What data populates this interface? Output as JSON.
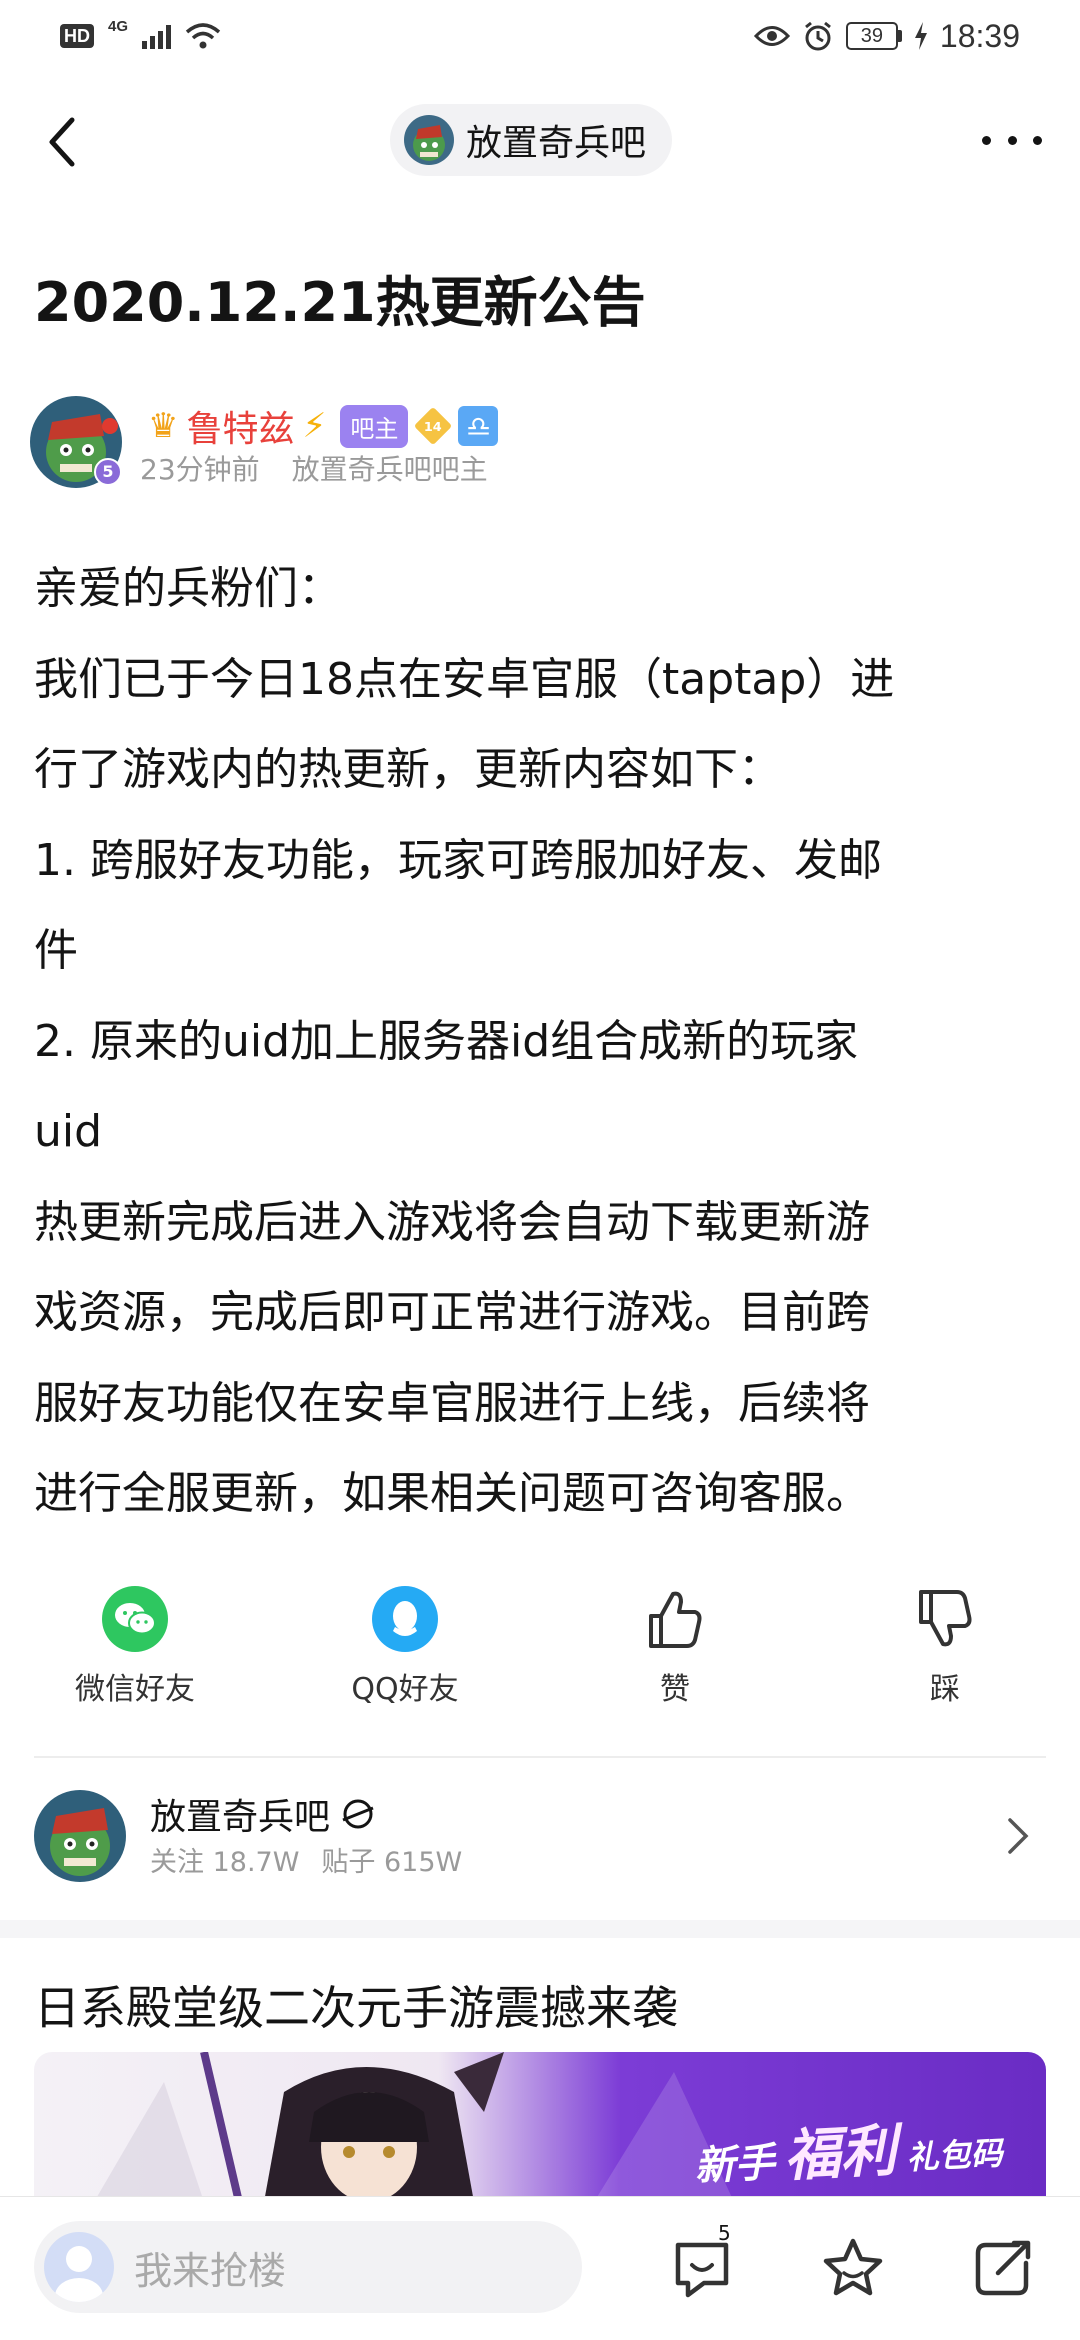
{
  "status_bar": {
    "hd": "HD",
    "network": "4G",
    "battery": "39",
    "time": "18:39"
  },
  "nav": {
    "forum_name": "放置奇兵吧"
  },
  "post": {
    "title": "2020.12.21热更新公告",
    "author": {
      "name": "鲁特兹",
      "role_tag": "吧主",
      "level": "14",
      "avatar_level": "5",
      "time": "23分钟前",
      "description": "放置奇兵吧吧主"
    },
    "content_lines": [
      "亲爱的兵粉们：",
      "我们已于今日18点在安卓官服（taptap）进",
      "行了游戏内的热更新，更新内容如下：",
      "1. 跨服好友功能，玩家可跨服加好友、发邮",
      "件",
      "2. 原来的uid加上服务器id组合成新的玩家",
      "uid",
      "热更新完成后进入游戏将会自动下载更新游",
      "戏资源，完成后即可正常进行游戏。目前跨",
      "服好友功能仅在安卓官服进行上线，后续将",
      "进行全服更新，如果相关问题可咨询客服。"
    ]
  },
  "actions": {
    "wechat": "微信好友",
    "qq": "QQ好友",
    "like": "赞",
    "dislike": "踩"
  },
  "forum_card": {
    "name": "放置奇兵吧",
    "followers": "关注 18.7W",
    "posts": "贴子 615W"
  },
  "ad": {
    "title": "日系殿堂级二次元手游震撼来袭",
    "banner_part1": "新手",
    "banner_part2": "福利",
    "banner_part3": "礼包码"
  },
  "bottom_bar": {
    "reply_placeholder": "我来抢楼",
    "comment_count": "5"
  },
  "colors": {
    "author_name": "#e8413b",
    "bazhu_tag": "#9b82f0",
    "wechat": "#2ec760",
    "qq": "#25aaf4"
  }
}
